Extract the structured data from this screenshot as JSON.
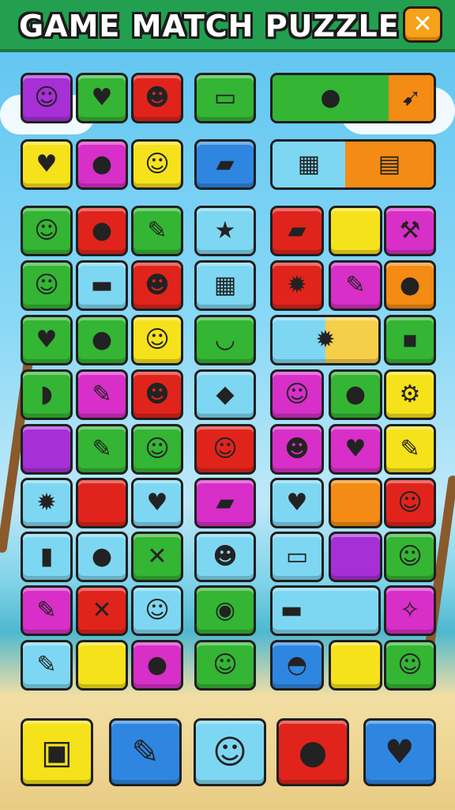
{
  "header": {
    "title": "GAME MATCH PUZZLE",
    "close_icon": "close-icon"
  },
  "palette": {
    "purple": "#a62fd6",
    "green": "#34b534",
    "red": "#e0241c",
    "yellow": "#f6e21b",
    "lightblue": "#7ed7f2",
    "blue": "#2f86e0",
    "orange": "#f38b14",
    "magenta": "#d72fc8"
  },
  "left_grid": [
    [
      {
        "c": "purple",
        "i": "☺",
        "n": "face-icon"
      },
      {
        "c": "green",
        "i": "♥",
        "n": "heart-icon"
      },
      {
        "c": "red",
        "i": "☻",
        "n": "bear-face-icon"
      }
    ],
    [
      {
        "c": "yellow",
        "i": "♥",
        "n": "heart-icon"
      },
      {
        "c": "magenta",
        "i": "●",
        "n": "apple-icon"
      },
      {
        "c": "yellow",
        "i": "☺",
        "n": "smiley-icon"
      }
    ],
    [
      {
        "c": "green",
        "i": "☺",
        "n": "cat-face-icon"
      },
      {
        "c": "red",
        "i": "●",
        "n": "orange-fruit-icon"
      },
      {
        "c": "green",
        "i": "✎",
        "n": "pencil-icon"
      }
    ],
    [
      {
        "c": "green",
        "i": "☺",
        "n": "blob-face-icon"
      },
      {
        "c": "lightblue",
        "i": "▬",
        "n": "ruler-icon"
      },
      {
        "c": "red",
        "i": "☻",
        "n": "bear-face-icon"
      }
    ],
    [
      {
        "c": "green",
        "i": "♥",
        "n": "heart-icon"
      },
      {
        "c": "green",
        "i": "●",
        "n": "apple-icon"
      },
      {
        "c": "yellow",
        "i": "☺",
        "n": "cat-face-icon"
      }
    ],
    [
      {
        "c": "green",
        "i": "◗",
        "n": "banana-icon"
      },
      {
        "c": "magenta",
        "i": "✎",
        "n": "crayon-icon"
      },
      {
        "c": "red",
        "i": "☻",
        "n": "bear-face-icon"
      }
    ],
    [
      {
        "c": "purple",
        "i": "",
        "n": "empty-tile"
      },
      {
        "c": "green",
        "i": "✎",
        "n": "pencil-icon"
      },
      {
        "c": "green",
        "i": "☺",
        "n": "ghost-face-icon"
      }
    ],
    [
      {
        "c": "lightblue",
        "i": "✹",
        "n": "star-creature-icon"
      },
      {
        "c": "red",
        "i": "",
        "n": "empty-tile"
      },
      {
        "c": "lightblue",
        "i": "♥",
        "n": "heart-icon"
      }
    ],
    [
      {
        "c": "lightblue",
        "i": "▮",
        "n": "cup-icon"
      },
      {
        "c": "lightblue",
        "i": "●",
        "n": "balloon-icon"
      },
      {
        "c": "green",
        "i": "✕",
        "n": "crossed-sticks-icon"
      }
    ],
    [
      {
        "c": "magenta",
        "i": "✎",
        "n": "pencil-icon"
      },
      {
        "c": "red",
        "i": "✕",
        "n": "crossed-tools-icon"
      },
      {
        "c": "lightblue",
        "i": "☺",
        "n": "blob-face-icon"
      }
    ],
    [
      {
        "c": "lightblue",
        "i": "✎",
        "n": "screwdriver-icon"
      },
      {
        "c": "yellow",
        "i": "",
        "n": "empty-tile"
      },
      {
        "c": "magenta",
        "i": "●",
        "n": "lemon-icon"
      }
    ]
  ],
  "mid_grid": [
    {
      "c": "green",
      "i": "▭",
      "n": "game-controller-icon"
    },
    {
      "c": "blue",
      "i": "▰",
      "n": "car-icon"
    },
    {
      "c": "lightblue",
      "i": "★",
      "n": "star-icon"
    },
    {
      "c": "lightblue",
      "i": "▦",
      "n": "bus-icon"
    },
    {
      "c": "green",
      "i": "◡",
      "n": "banana-icon"
    },
    {
      "c": "lightblue",
      "i": "◆",
      "n": "fish-icon"
    },
    {
      "c": "red",
      "i": "☺",
      "n": "blob-face-icon"
    },
    {
      "c": "magenta",
      "i": "▰",
      "n": "car-icon"
    },
    {
      "c": "lightblue",
      "i": "☻",
      "n": "blob-face-icon"
    },
    {
      "c": "green",
      "i": "◉",
      "n": "compass-icon"
    },
    {
      "c": "green",
      "i": "☺",
      "n": "ghost-face-icon"
    }
  ],
  "right_bars": [
    {
      "segs": [
        {
          "c": "green",
          "i": "●",
          "n": "balloon-icon",
          "w": 0.72
        },
        {
          "c": "orange",
          "i": "➹",
          "n": "kite-icon",
          "w": 0.28
        }
      ]
    },
    {
      "segs": [
        {
          "c": "lightblue",
          "i": "▦",
          "n": "bus-icon",
          "w": 0.45
        },
        {
          "c": "orange",
          "i": "▤",
          "n": "sign-icon",
          "w": 0.55
        }
      ]
    }
  ],
  "right_grid": [
    [
      {
        "c": "red",
        "i": "▰",
        "n": "car-icon"
      },
      {
        "c": "yellow",
        "i": "",
        "n": "empty-tile"
      },
      {
        "c": "magenta",
        "i": "⚒",
        "n": "wrench-icon"
      }
    ],
    [
      {
        "c": "red",
        "i": "✹",
        "n": "star-creature-icon"
      },
      {
        "c": "magenta",
        "i": "✎",
        "n": "pencil-icon"
      },
      {
        "c": "orange",
        "i": "●",
        "n": "pepper-icon"
      }
    ],
    [
      {
        "c": "bar-lightblue-yellow",
        "i": "✹",
        "n": "star-creature-icon"
      },
      {
        "c": "green",
        "i": "▪",
        "n": "box-icon"
      }
    ],
    [
      {
        "c": "magenta",
        "i": "☺",
        "n": "bear-face-icon"
      },
      {
        "c": "green",
        "i": "●",
        "n": "tennis-ball-icon"
      },
      {
        "c": "yellow",
        "i": "⚙",
        "n": "robot-icon"
      }
    ],
    [
      {
        "c": "magenta",
        "i": "☻",
        "n": "blob-face-icon"
      },
      {
        "c": "magenta",
        "i": "♥",
        "n": "balloon-icon"
      },
      {
        "c": "yellow",
        "i": "✎",
        "n": "pencil-icon"
      }
    ],
    [
      {
        "c": "lightblue",
        "i": "♥",
        "n": "heart-icon"
      },
      {
        "c": "orange",
        "i": "",
        "n": "empty-tile"
      },
      {
        "c": "red",
        "i": "☺",
        "n": "pig-face-icon"
      }
    ],
    [
      {
        "c": "lightblue",
        "i": "▭",
        "n": "board-icon"
      },
      {
        "c": "purple",
        "i": "",
        "n": "empty-tile"
      },
      {
        "c": "green",
        "i": "☺",
        "n": "cat-face-icon"
      }
    ],
    [
      {
        "c": "bar-lightblue",
        "i": "▬",
        "n": "key-icon"
      },
      {
        "c": "magenta",
        "i": "✧",
        "n": "branch-icon"
      }
    ],
    [
      {
        "c": "blue",
        "i": "◓",
        "n": "magnifier-icon"
      },
      {
        "c": "yellow",
        "i": "",
        "n": "empty-tile"
      },
      {
        "c": "green",
        "i": "☺",
        "n": "cat-face-icon"
      }
    ]
  ],
  "tray": [
    {
      "c": "yellow",
      "i": "▣",
      "n": "picture-frame-icon"
    },
    {
      "c": "blue",
      "i": "✎",
      "n": "pencil-ball-icon"
    },
    {
      "c": "lightblue",
      "i": "☺",
      "n": "blob-face-icon"
    },
    {
      "c": "red",
      "i": "●",
      "n": "blob-icon"
    },
    {
      "c": "blue",
      "i": "♥",
      "n": "heart-icon"
    }
  ]
}
